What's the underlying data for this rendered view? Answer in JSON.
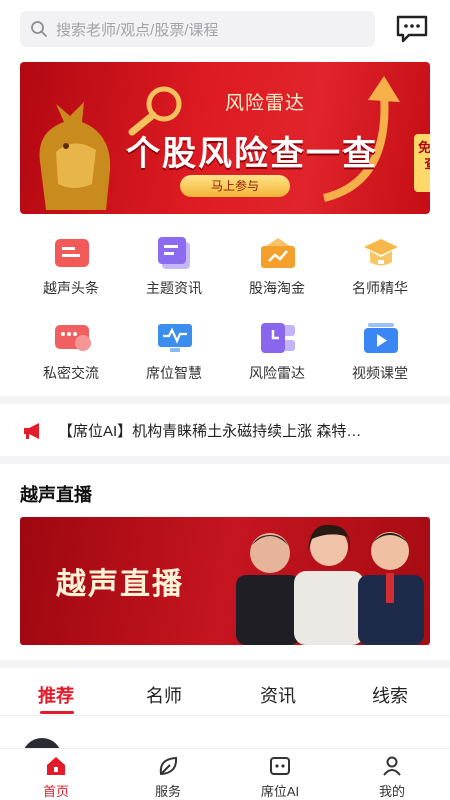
{
  "search": {
    "placeholder": "搜索老师/观点/股票/课程"
  },
  "banner": {
    "subtitle": "风险雷达",
    "headline": "个股风险查一查",
    "cta": "马上参与",
    "badge": "免费查"
  },
  "grid": [
    {
      "label": "越声头条",
      "icon": "news-icon",
      "color": "#f25a5a"
    },
    {
      "label": "主题资讯",
      "icon": "document-icon",
      "color": "#8b6cf0"
    },
    {
      "label": "股海淘金",
      "icon": "trend-box-icon",
      "color": "#f4a02c"
    },
    {
      "label": "名师精华",
      "icon": "graduation-cap-icon",
      "color": "#f7b84a"
    },
    {
      "label": "私密交流",
      "icon": "chat-icon",
      "color": "#f06060"
    },
    {
      "label": "席位智慧",
      "icon": "monitor-pulse-icon",
      "color": "#3b8df0"
    },
    {
      "label": "风险雷达",
      "icon": "clock-icon",
      "color": "#8a66ee"
    },
    {
      "label": "视频课堂",
      "icon": "play-icon",
      "color": "#3b86f5"
    }
  ],
  "ticker": {
    "text": "【席位AI】机构青睐稀土永磁持续上涨  森特…"
  },
  "live": {
    "section_title": "越声直播",
    "banner_text": "越声直播"
  },
  "tabs": [
    {
      "label": "推荐",
      "active": true
    },
    {
      "label": "名师",
      "active": false
    },
    {
      "label": "资讯",
      "active": false
    },
    {
      "label": "线索",
      "active": false
    }
  ],
  "bottom_nav": [
    {
      "label": "首页",
      "icon": "home-icon",
      "active": true
    },
    {
      "label": "服务",
      "icon": "leaf-icon",
      "active": false
    },
    {
      "label": "席位AI",
      "icon": "ai-icon",
      "active": false
    },
    {
      "label": "我的",
      "icon": "user-icon",
      "active": false
    }
  ],
  "colors": {
    "accent": "#e21c2a",
    "banner_red": "#de1b22"
  }
}
